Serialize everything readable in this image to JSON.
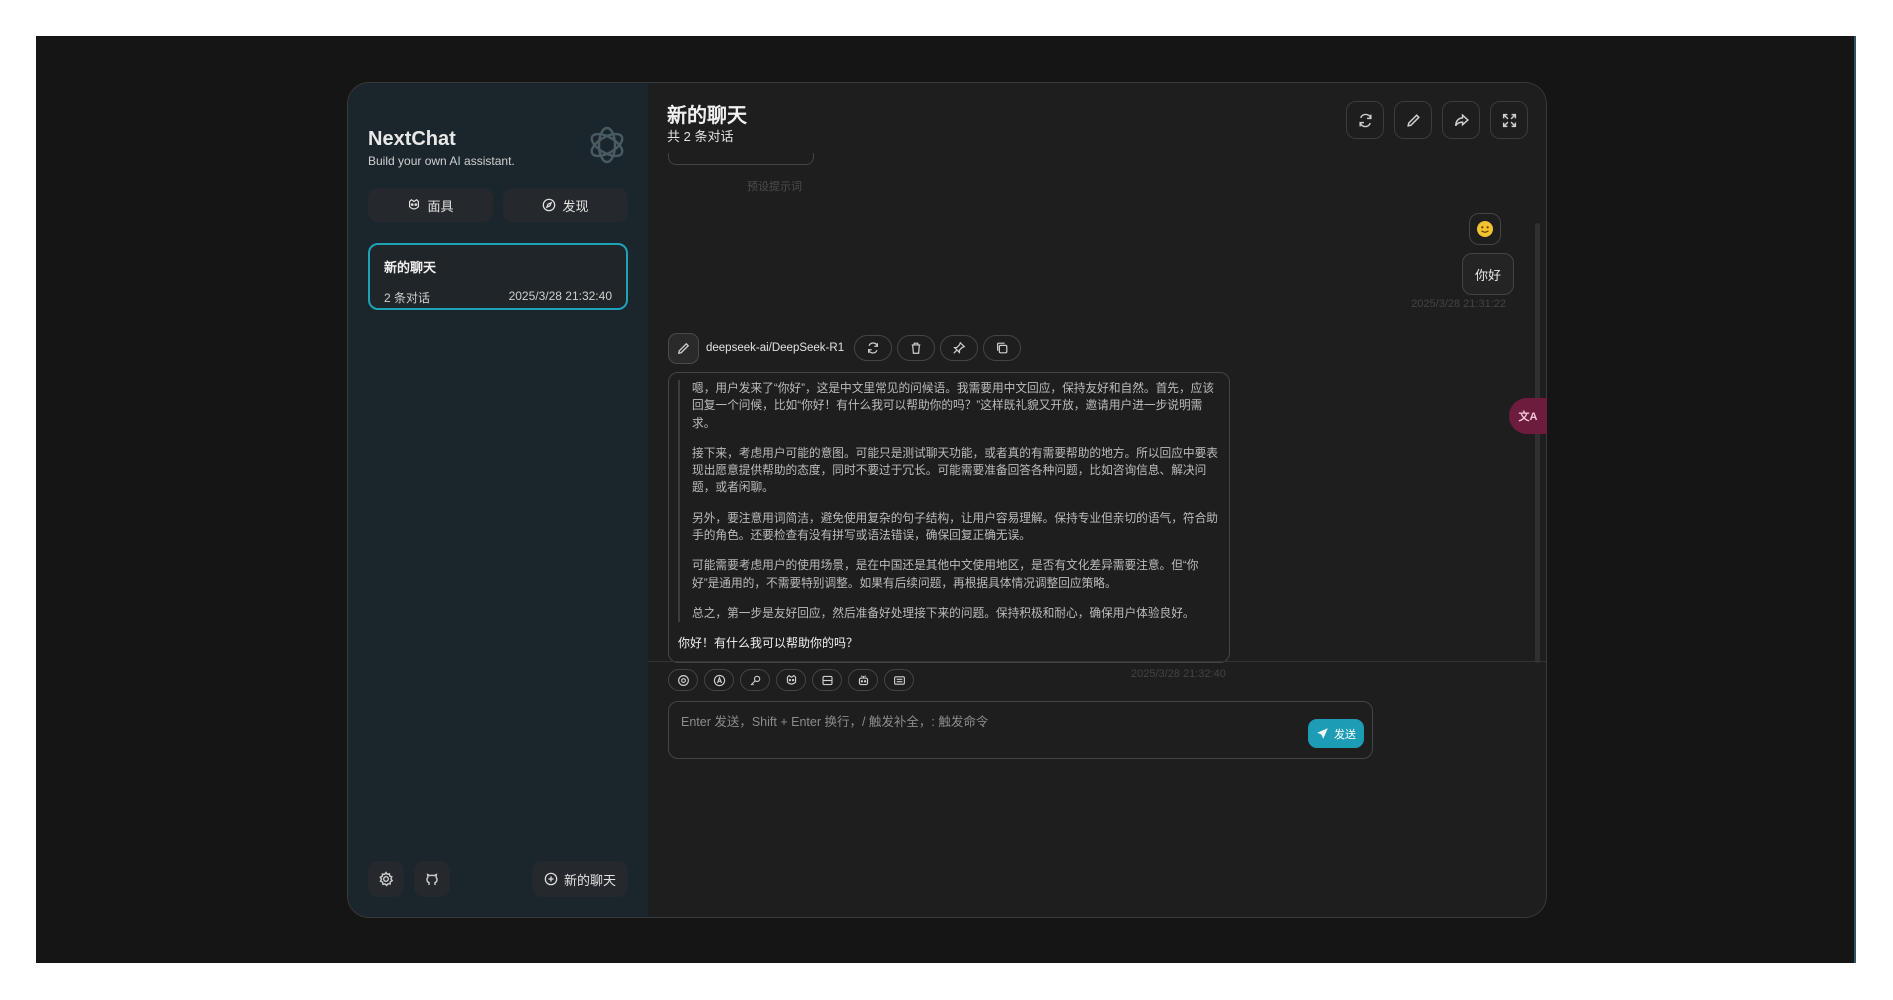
{
  "app": {
    "name": "NextChat",
    "tagline": "Build your own AI assistant."
  },
  "sidebar": {
    "tabs": [
      {
        "label": "面具",
        "icon": "mask-icon"
      },
      {
        "label": "发现",
        "icon": "compass-icon"
      }
    ],
    "chats": [
      {
        "title": "新的聊天",
        "count": "2 条对话",
        "time": "2025/3/28 21:32:40",
        "selected": true
      }
    ],
    "footer": {
      "settings_icon": "gear-icon",
      "github_icon": "github-icon",
      "new_chat_label": "新的聊天"
    }
  },
  "header": {
    "title": "新的聊天",
    "subtitle": "共 2 条对话",
    "actions": [
      "refresh-icon",
      "edit-icon",
      "share-icon",
      "fullscreen-icon"
    ]
  },
  "messages": {
    "preset_label": "预设提示词",
    "user": {
      "avatar": "emoji-avatar",
      "text": "你好",
      "time": "2025/3/28 21:31:22"
    },
    "bot": {
      "model": "deepseek-ai/DeepSeek-R1",
      "actions": [
        "retry-icon",
        "delete-icon",
        "pin-icon",
        "copy-icon"
      ],
      "thinking": [
        "嗯，用户发来了“你好”，这是中文里常见的问候语。我需要用中文回应，保持友好和自然。首先，应该回复一个问候，比如“你好！有什么我可以帮助你的吗？”这样既礼貌又开放，邀请用户进一步说明需求。",
        "接下来，考虑用户可能的意图。可能只是测试聊天功能，或者真的有需要帮助的地方。所以回应中要表现出愿意提供帮助的态度，同时不要过于冗长。可能需要准备回答各种问题，比如咨询信息、解决问题，或者闲聊。",
        "另外，要注意用词简洁，避免使用复杂的句子结构，让用户容易理解。保持专业但亲切的语气，符合助手的角色。还要检查有没有拼写或语法错误，确保回复正确无误。",
        "可能需要考虑用户的使用场景，是在中国还是其他中文使用地区，是否有文化差异需要注意。但“你好”是通用的，不需要特别调整。如果有后续问题，再根据具体情况调整回应策略。",
        "总之，第一步是友好回应，然后准备好处理接下来的问题。保持积极和耐心，确保用户体验良好。"
      ],
      "answer": "你好！有什么我可以帮助你的吗？",
      "time": "2025/3/28 21:32:40"
    }
  },
  "input": {
    "tools": [
      "settings-icon",
      "theme-icon",
      "prompt-icon",
      "mask-icon",
      "clear-context-icon",
      "model-icon",
      "shortcut-icon"
    ],
    "placeholder": "Enter 发送，Shift + Enter 换行，/ 触发补全，: 触发命令",
    "send_label": "发送"
  },
  "overlay": {
    "translate_label": "文A"
  },
  "colors": {
    "accent": "#1c9db5",
    "sidebar_bg": "#1b262c",
    "main_bg": "#1e1e1e"
  }
}
